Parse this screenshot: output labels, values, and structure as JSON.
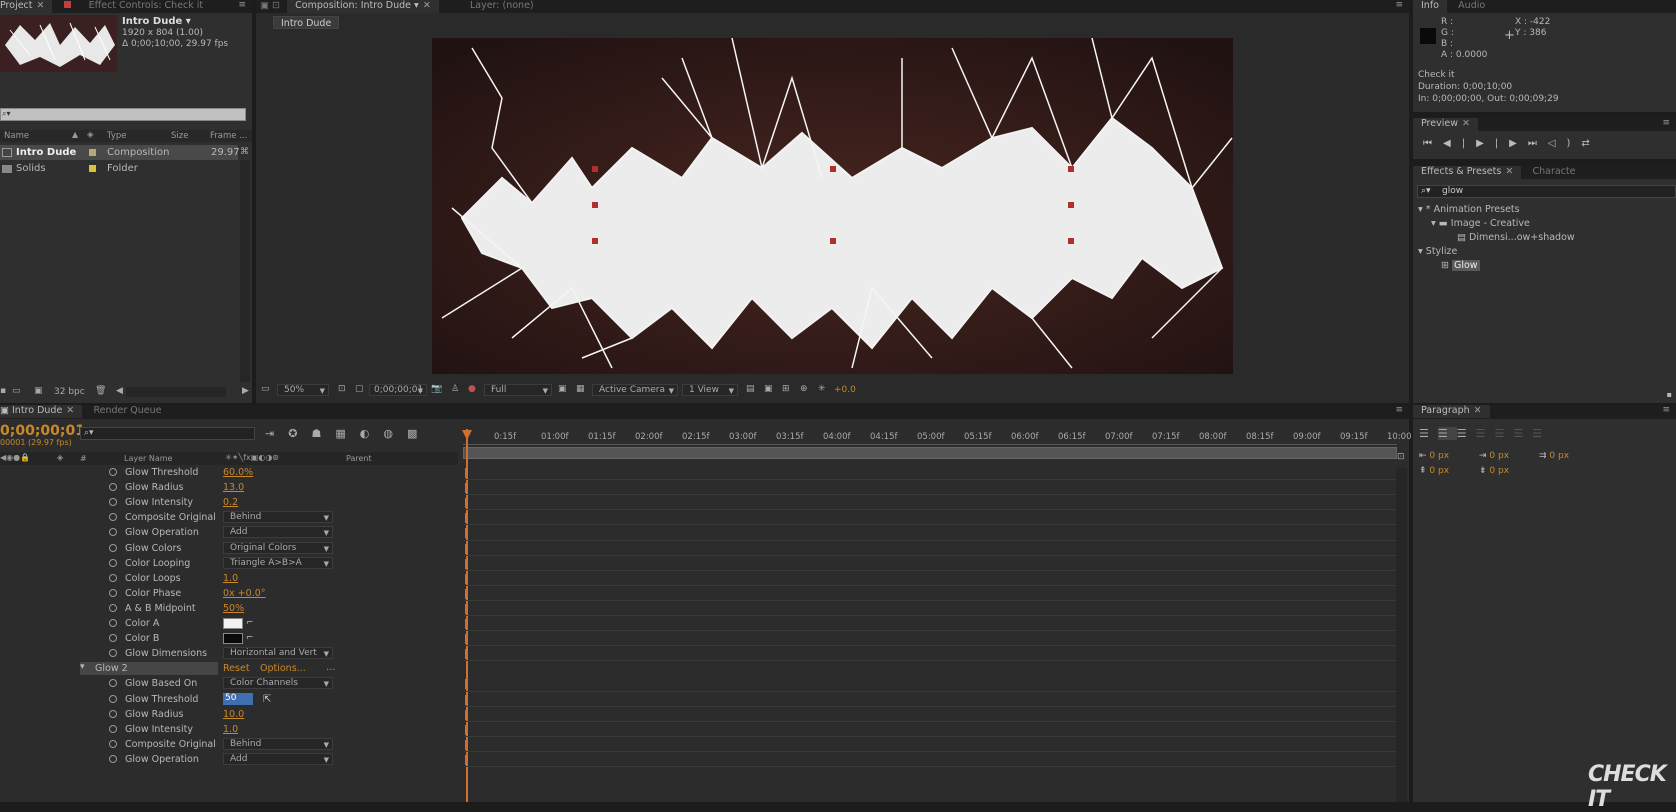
{
  "project_panel": {
    "tabs": [
      "Project",
      "Effect Controls: Check it"
    ],
    "item_name": "Intro Dude ▾",
    "item_size": "1920 x 804 (1.00)",
    "item_duration": "Δ 0;00;10;00, 29.97 fps",
    "columns": [
      "Name",
      "Type",
      "Size",
      "Frame ..."
    ],
    "rows": [
      {
        "name": "Intro Dude",
        "type": "Composition",
        "size": "",
        "frame": "29.97",
        "color": "#b9a777"
      },
      {
        "name": "Solids",
        "type": "Folder",
        "size": "",
        "frame": "",
        "color": "#d8c33b"
      }
    ],
    "bpc": "32 bpc"
  },
  "comp_panel": {
    "tabs": [
      "Composition: Intro Dude",
      "Layer: (none)"
    ],
    "subtab": "Intro Dude",
    "zoom": "50%",
    "timecode": "0;00;00;01",
    "resolution": "Full",
    "camera": "Active Camera",
    "views": "1 View",
    "exposure": "+0.0"
  },
  "info_panel": {
    "tabs": [
      "Info",
      "Audio"
    ],
    "r": "R :",
    "g": "G :",
    "b": "B :",
    "a": "A : 0.0000",
    "x": "X : -422",
    "y": "Y : 386",
    "name": "Check it",
    "duration": "Duration: 0;00;10;00",
    "inout": "In: 0;00;00;00, Out: 0;00;09;29"
  },
  "preview_panel": {
    "tab": "Preview"
  },
  "effects_panel": {
    "tabs": [
      "Effects & Presets",
      "Characte"
    ],
    "search": "glow",
    "tree": [
      "* Animation Presets",
      "Image - Creative",
      "Dimensi...ow+shadow",
      "Stylize",
      "Glow"
    ]
  },
  "paragraph_panel": {
    "tab": "Paragraph",
    "values": [
      "0 px",
      "0 px",
      "0 px",
      "0 px",
      "0 px"
    ]
  },
  "timeline": {
    "tabs": [
      "Intro Dude",
      "Render Queue"
    ],
    "timecode": "0;00;00;01",
    "fps": "00001 (29.97 fps)",
    "col_layer": "Layer Name",
    "col_num": "#",
    "col_parent": "Parent",
    "ruler": [
      "0:15f",
      "01:00f",
      "01:15f",
      "02:00f",
      "02:15f",
      "03:00f",
      "03:15f",
      "04:00f",
      "04:15f",
      "05:00f",
      "05:15f",
      "06:00f",
      "06:15f",
      "07:00f",
      "07:15f",
      "08:00f",
      "08:15f",
      "09:00f",
      "09:15f",
      "10:00"
    ],
    "group_label": "Glow 2",
    "reset": "Reset",
    "options": "Options...",
    "props": [
      {
        "name": "Glow Threshold",
        "value": "60.0%",
        "kind": "num"
      },
      {
        "name": "Glow Radius",
        "value": "13.0",
        "kind": "num"
      },
      {
        "name": "Glow Intensity",
        "value": "0.2",
        "kind": "num"
      },
      {
        "name": "Composite Original",
        "value": "Behind",
        "kind": "dd"
      },
      {
        "name": "Glow Operation",
        "value": "Add",
        "kind": "dd"
      },
      {
        "name": "Glow Colors",
        "value": "Original Colors",
        "kind": "dd"
      },
      {
        "name": "Color Looping",
        "value": "Triangle A>B>A",
        "kind": "dd"
      },
      {
        "name": "Color Loops",
        "value": "1.0",
        "kind": "num"
      },
      {
        "name": "Color Phase",
        "value": "0x +0.0°",
        "kind": "num"
      },
      {
        "name": "A & B Midpoint",
        "value": "50%",
        "kind": "num"
      },
      {
        "name": "Color A",
        "value": "#f2f2f2",
        "kind": "color"
      },
      {
        "name": "Color B",
        "value": "#0a0a0a",
        "kind": "color"
      },
      {
        "name": "Glow Dimensions",
        "value": "Horizontal and Vert",
        "kind": "dd"
      }
    ],
    "props2": [
      {
        "name": "Glow Based On",
        "value": "Color Channels",
        "kind": "dd"
      },
      {
        "name": "Glow Threshold",
        "value": "50",
        "kind": "edit"
      },
      {
        "name": "Glow Radius",
        "value": "10.0",
        "kind": "num"
      },
      {
        "name": "Glow Intensity",
        "value": "1.0",
        "kind": "num"
      },
      {
        "name": "Composite Original",
        "value": "Behind",
        "kind": "dd"
      },
      {
        "name": "Glow Operation",
        "value": "Add",
        "kind": "dd"
      }
    ]
  },
  "watermark": "CHECK IT"
}
